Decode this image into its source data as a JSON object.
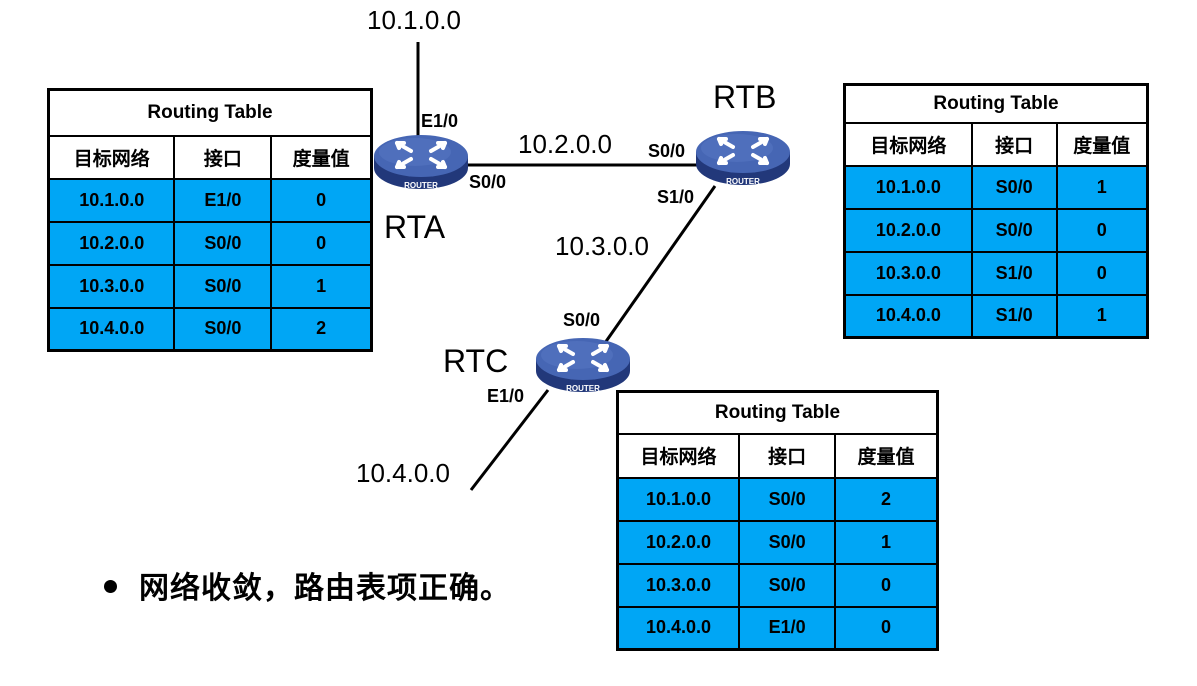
{
  "networks": {
    "n1": "10.1.0.0",
    "n2": "10.2.0.0",
    "n3": "10.3.0.0",
    "n4": "10.4.0.0"
  },
  "routers": {
    "rta": {
      "name": "RTA",
      "icon_text": "ROUTER",
      "interfaces": {
        "e10": "E1/0",
        "s00": "S0/0"
      }
    },
    "rtb": {
      "name": "RTB",
      "icon_text": "ROUTER",
      "interfaces": {
        "s00": "S0/0",
        "s10": "S1/0"
      }
    },
    "rtc": {
      "name": "RTC",
      "icon_text": "ROUTER",
      "interfaces": {
        "s00": "S0/0",
        "e10": "E1/0"
      }
    }
  },
  "colors": {
    "table_row_fill": "#00a6f5",
    "router_body": "#3d5aa3",
    "router_top": "#4b6bb8",
    "router_side": "#22387a"
  },
  "tables": {
    "rta": {
      "title": "Routing Table",
      "headers": [
        "目标网络",
        "接口",
        "度量值"
      ],
      "rows": [
        [
          "10.1.0.0",
          "E1/0",
          "0"
        ],
        [
          "10.2.0.0",
          "S0/0",
          "0"
        ],
        [
          "10.3.0.0",
          "S0/0",
          "1"
        ],
        [
          "10.4.0.0",
          "S0/0",
          "2"
        ]
      ]
    },
    "rtb": {
      "title": "Routing Table",
      "headers": [
        "目标网络",
        "接口",
        "度量值"
      ],
      "rows": [
        [
          "10.1.0.0",
          "S0/0",
          "1"
        ],
        [
          "10.2.0.0",
          "S0/0",
          "0"
        ],
        [
          "10.3.0.0",
          "S1/0",
          "0"
        ],
        [
          "10.4.0.0",
          "S1/0",
          "1"
        ]
      ]
    },
    "rtc": {
      "title": "Routing Table",
      "headers": [
        "目标网络",
        "接口",
        "度量值"
      ],
      "rows": [
        [
          "10.1.0.0",
          "S0/0",
          "2"
        ],
        [
          "10.2.0.0",
          "S0/0",
          "1"
        ],
        [
          "10.3.0.0",
          "S0/0",
          "0"
        ],
        [
          "10.4.0.0",
          "E1/0",
          "0"
        ]
      ]
    }
  },
  "bullet_text": "网络收敛，路由表项正确。"
}
